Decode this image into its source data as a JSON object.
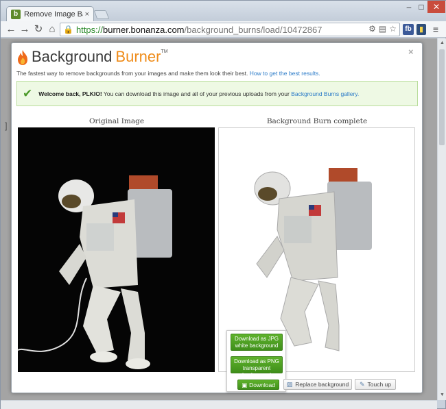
{
  "browser": {
    "tab_title": "Remove Image Backgro",
    "tab_close": "×",
    "url_scheme": "https://",
    "url_host": "burner.bonanza.com",
    "url_path": "/background_burns/load/10472867",
    "ext_fb": "fb"
  },
  "modal": {
    "logo_part1": "Background",
    "logo_part2": "Burner",
    "logo_tm": "TM",
    "close": "×",
    "tagline": "The fastest way to remove backgrounds from your images and make them look their best.",
    "tagline_link": "How to get the best results.",
    "alert_bold": "Welcome back, PLKIO!",
    "alert_text": "You can download this image and all of your previous uploads from your",
    "alert_link": "Background Burns gallery.",
    "original_title": "Original Image",
    "result_title": "Background Burn complete"
  },
  "actions": {
    "jpg_line1": "Download as JPG",
    "jpg_line2": "white background",
    "png_line1": "Download as PNG",
    "png_line2": "transparent background",
    "download": "Download",
    "replace": "Replace background",
    "touch_up": "Touch up"
  },
  "colors": {
    "brand_orange": "#ef8c1a",
    "button_green": "#4fa024",
    "alert_bg": "#eef9e4",
    "link_blue": "#2b7bc8"
  }
}
